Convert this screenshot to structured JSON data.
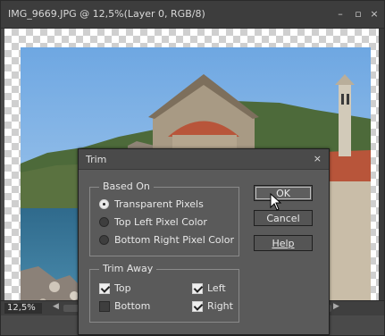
{
  "window": {
    "title": "IMG_9669.JPG @ 12,5%(Layer 0, RGB/8)",
    "minimize_glyph": "–",
    "restore_glyph": "▫",
    "close_glyph": "×"
  },
  "status": {
    "zoom": "12,5%",
    "scroll_left_glyph": "◀",
    "scroll_right_glyph": "▶"
  },
  "dialog": {
    "title": "Trim",
    "close_glyph": "×",
    "based_on": {
      "label": "Based On",
      "options": [
        {
          "label": "Transparent Pixels",
          "selected": true
        },
        {
          "label": "Top Left Pixel Color",
          "selected": false
        },
        {
          "label": "Bottom Right Pixel Color",
          "selected": false
        }
      ]
    },
    "trim_away": {
      "label": "Trim Away",
      "top": {
        "label": "Top",
        "checked": true
      },
      "bottom": {
        "label": "Bottom",
        "checked": false
      },
      "left": {
        "label": "Left",
        "checked": true
      },
      "right": {
        "label": "Right",
        "checked": true
      }
    },
    "buttons": {
      "ok": "OK",
      "cancel": "Cancel",
      "help": "Help"
    }
  },
  "colors": {
    "app_background": "#4a4a4a",
    "dialog_background": "#5a5a5a",
    "sky": "#7fb2e6",
    "roof": "#b8553a"
  }
}
